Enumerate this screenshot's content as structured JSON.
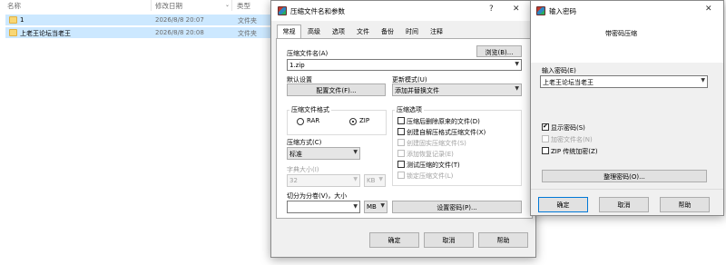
{
  "explorer": {
    "columns": {
      "name": "名称",
      "modified": "修改日期",
      "type": "类型"
    },
    "rows": [
      {
        "name": "1",
        "date": "2026/8/8 20:07",
        "type": "文件夹"
      },
      {
        "name": "上老王论坛当老王",
        "date": "2026/8/8 20:08",
        "type": "文件夹"
      }
    ]
  },
  "archive_dialog": {
    "title": "压缩文件名和参数",
    "help_glyph": "?",
    "close_glyph": "✕",
    "tabs": [
      "常规",
      "高级",
      "选项",
      "文件",
      "备份",
      "时间",
      "注释"
    ],
    "archive_name_label": "压缩文件名(A)",
    "browse_button": "浏览(B)...",
    "archive_name_value": "1.zip",
    "default_settings_label": "默认设置",
    "profiles_button": "配置文件(F)...",
    "update_mode_label": "更新模式(U)",
    "update_mode_value": "添加并替换文件",
    "format_group_label": "压缩文件格式",
    "format_rar": "RAR",
    "format_zip": "ZIP",
    "options_group_label": "压缩选项",
    "options": [
      {
        "label": "压缩后删除原来的文件(D)",
        "checked": false,
        "enabled": true
      },
      {
        "label": "创建自解压格式压缩文件(X)",
        "checked": false,
        "enabled": true
      },
      {
        "label": "创建固实压缩文件(S)",
        "checked": false,
        "enabled": false
      },
      {
        "label": "添加恢复记录(E)",
        "checked": false,
        "enabled": false
      },
      {
        "label": "测试压缩的文件(T)",
        "checked": false,
        "enabled": true
      },
      {
        "label": "锁定压缩文件(L)",
        "checked": false,
        "enabled": false
      }
    ],
    "method_label": "压缩方式(C)",
    "method_value": "标准",
    "dict_label": "字典大小(I)",
    "dict_value": "32",
    "dict_unit": "KB",
    "split_label": "切分为分卷(V)，大小",
    "split_unit": "MB",
    "set_password_button": "设置密码(P)...",
    "ok_button": "确定",
    "cancel_button": "取消",
    "help_button": "帮助"
  },
  "password_dialog": {
    "title": "输入密码",
    "close_glyph": "✕",
    "heading": "带密码压缩",
    "enter_password_label": "输入密码(E)",
    "password_value": "上老王论坛当老王",
    "show_password_label": "显示密码(S)",
    "show_password_checked": true,
    "encrypt_names_label": "加密文件名(N)",
    "zip_legacy_label": "ZIP 传统加密(Z)",
    "organize_button": "整理密码(O)...",
    "ok_button": "确定",
    "cancel_button": "取消",
    "help_button": "帮助"
  }
}
